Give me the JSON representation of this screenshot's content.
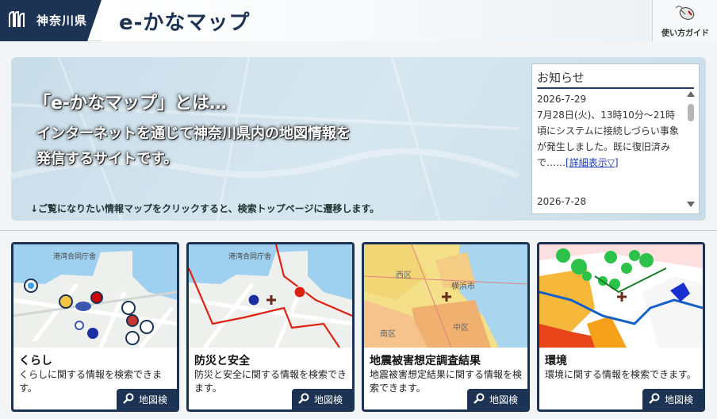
{
  "header": {
    "prefecture": "神奈川県",
    "logo": "e-かなマップ",
    "guide_label": "使い方ガイド"
  },
  "hero": {
    "title": "「e-かなマップ」とは…",
    "line1": "インターネットを通じて神奈川県内の地図情報を",
    "line2": "発信するサイトです。",
    "hint": "↓ご覧になりたい情報マップをクリックすると、検索トップページに遷移します。"
  },
  "news": {
    "title": "お知らせ",
    "items": [
      {
        "date": "2026-7-29",
        "text": "7月28日(火)、13時10分～21時頃にシステムに接続しづらい事象が発生しました。既に復旧済みで……",
        "link": "[詳細表示▽]"
      },
      {
        "date": "2026-7-28"
      }
    ]
  },
  "cards": [
    {
      "title": "くらし",
      "desc": "くらしに関する情報を検索できます。",
      "button": "地図検"
    },
    {
      "title": "防災と安全",
      "desc": "防災と安全に関する情報を検索できます。",
      "button": "地図検"
    },
    {
      "title": "地震被害想定調査結果",
      "desc": "地震被害想定結果に関する情報を検索できます。",
      "button": "地図検"
    },
    {
      "title": "環境",
      "desc": "環境に関する情報を検索できます。",
      "button": "地図検"
    }
  ],
  "map_labels": {
    "harbor_office": "港湾合同庁舎",
    "nishi_ku": "西区",
    "yokohama_city": "横浜市",
    "minami_ku": "南区",
    "naka_ku": "中区"
  },
  "colors": {
    "navy": "#1c3354",
    "hero_bg": "#cfe2ec",
    "link": "#1a3ab5"
  }
}
